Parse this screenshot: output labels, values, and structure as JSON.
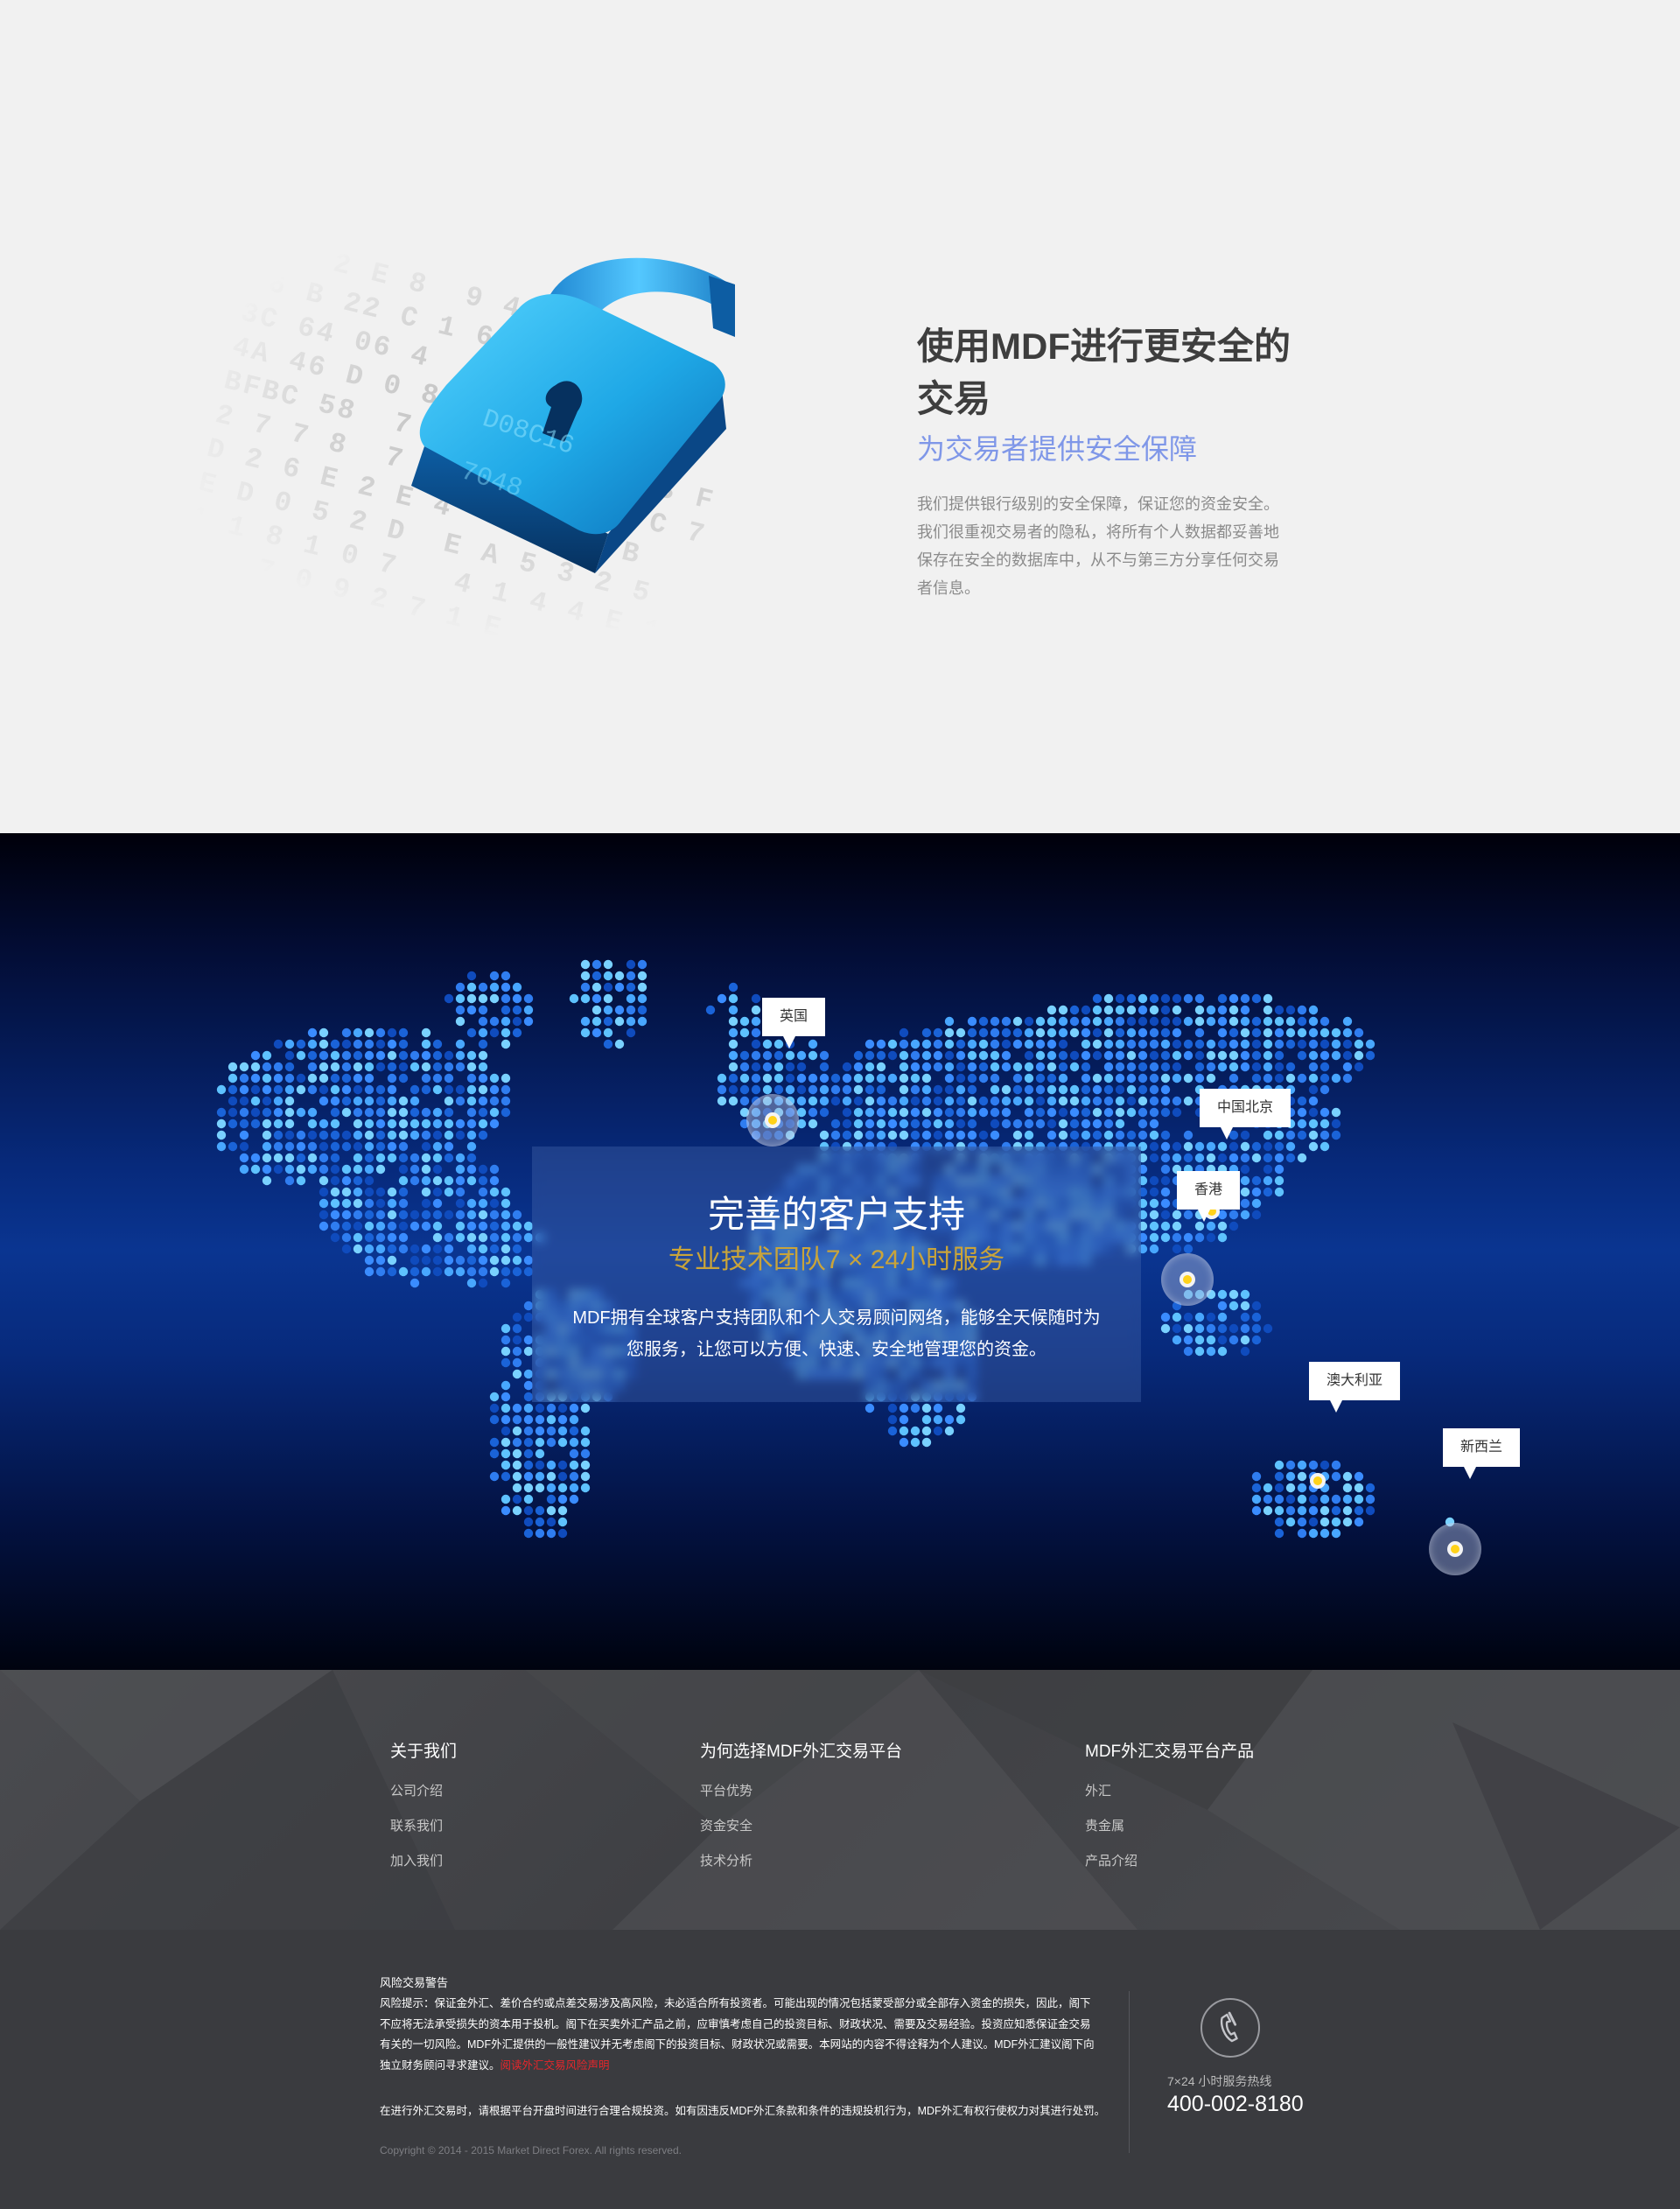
{
  "security": {
    "code_rows": [
      "  1 2 E 8  9 4 A 3 D",
      "26 B 22 C 1 6 4 7 B",
      "3C 64 06 4  A 3 B 9 2",
      "4A 46 D 0 8 C 1 6 0",
      "BFBC 58  7 0 4 B 9 0 5 3 F",
      "2 7 7 8  7 D 1 E 4 7 6 C 7",
      "D 2 6 E 2 E 4   3 E 5 B",
      "E D 0 5 2 D  E A 5 3 2 5",
      "1 1 8 1 0 7   4 1 4 4 E 1",
      "6 C 7 0 9 2 7 1 E"
    ],
    "title": "使用MDF进行更安全的交易",
    "subtitle": "为交易者提供安全保障",
    "body": "我们提供银行级别的安全保障，保证您的资金安全。我们很重视交易者的隐私，将所有个人数据都妥善地保存在安全的数据库中，从不与第三方分享任何交易者信息。",
    "lock_color": "#1fa8e6",
    "icon": "padlock-icon"
  },
  "support": {
    "title": "完善的客户支持",
    "subtitle": "专业技术团队7 × 24小时服务",
    "body": "MDF拥有全球客户支持团队和个人交易顾问网络，能够全天候随时为您服务，让您可以方便、快速、安全地管理您的资金。",
    "cities": [
      "英国",
      "中国北京",
      "香港",
      "澳大利亚",
      "新西兰"
    ],
    "accent": "#c9a43a",
    "marker_color": "#ffd21a"
  },
  "footer": {
    "columns": [
      {
        "title": "关于我们",
        "links": [
          "公司介绍",
          "联系我们",
          "加入我们"
        ]
      },
      {
        "title": "为何选择MDF外汇交易平台",
        "links": [
          "平台优势",
          "资金安全",
          "技术分析"
        ]
      },
      {
        "title": "MDF外汇交易平台产品",
        "links": [
          "外汇",
          "贵金属",
          "产品介绍"
        ]
      }
    ],
    "risk_title": "风险交易警告",
    "risk_text": "风险提示：保证金外汇、差价合约或点差交易涉及高风险，未必适合所有投资者。可能出现的情况包括蒙受部分或全部存入资金的损失，因此，阁下不应将无法承受损失的资本用于投机。阁下在买卖外汇产品之前，应审慎考虑自己的投资目标、财政状况、需要及交易经验。投资应知悉保证金交易有关的一切风险。MDF外汇提供的一般性建议并无考虑阁下的投资目标、财政状况或需要。本网站的内容不得诠释为个人建议。MDF外汇建议阁下向独立财务顾问寻求建议。",
    "risk_link": "阅读外汇交易风险声明",
    "note": "在进行外汇交易时，请根据平台开盘时间进行合理合规投资。如有因违反MDF外汇条款和条件的违规投机行为，MDF外汇有权行使权力对其进行处罚。",
    "copyright": "Copyright © 2014 - 2015 Market Direct Forex. All rights reserved.",
    "hotline_label": "7×24 小时服务热线",
    "hotline_number": "400-002-8180",
    "phone_icon": "phone-icon",
    "risk_link_color": "#e8262b"
  }
}
